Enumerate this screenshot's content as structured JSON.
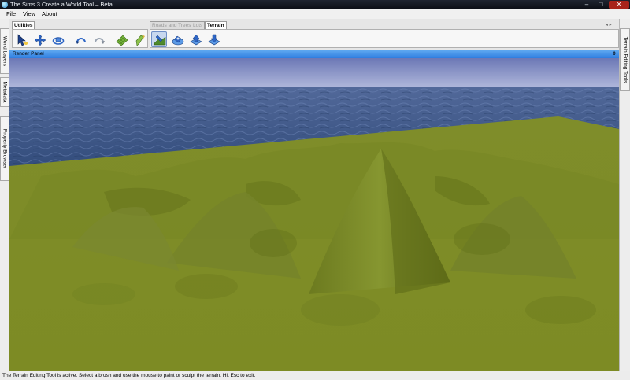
{
  "window": {
    "title": "The Sims 3 Create a World Tool – Beta",
    "controls": {
      "minimize": "–",
      "maximize": "□",
      "close": "✕"
    }
  },
  "menu": [
    "File",
    "View",
    "About"
  ],
  "left_panels": [
    "World Layers",
    "Metadata",
    "Property Browser"
  ],
  "right_panels": [
    "Terrain Editing Tools"
  ],
  "toolbar": {
    "utilities_tab": "Utilities",
    "tabs": [
      "Roads and Trees",
      "Lots",
      "Terrain"
    ],
    "active_tab": "Terrain",
    "nav": "◂ ▸",
    "utility_tools": [
      "select-arrow-icon",
      "move-icon",
      "camera-orbit-icon",
      "undo-icon",
      "redo-icon",
      "grid-icon",
      "brush-pick-icon"
    ],
    "terrain_tools": [
      "terrain-sculpt-icon",
      "terrain-smooth-icon",
      "terrain-raise-icon",
      "terrain-lower-icon"
    ]
  },
  "render_panel": {
    "title": "Render Panel",
    "pin": "⇟"
  },
  "status": "The Terrain Editing Tool is active. Select a brush and use the mouse to paint or sculpt the terrain. Hit Esc to exit.",
  "colors": {
    "sky": "#7d89c4",
    "water": "#3b5684",
    "terrain": "#7f8d2a",
    "accent": "#3d8be6"
  }
}
